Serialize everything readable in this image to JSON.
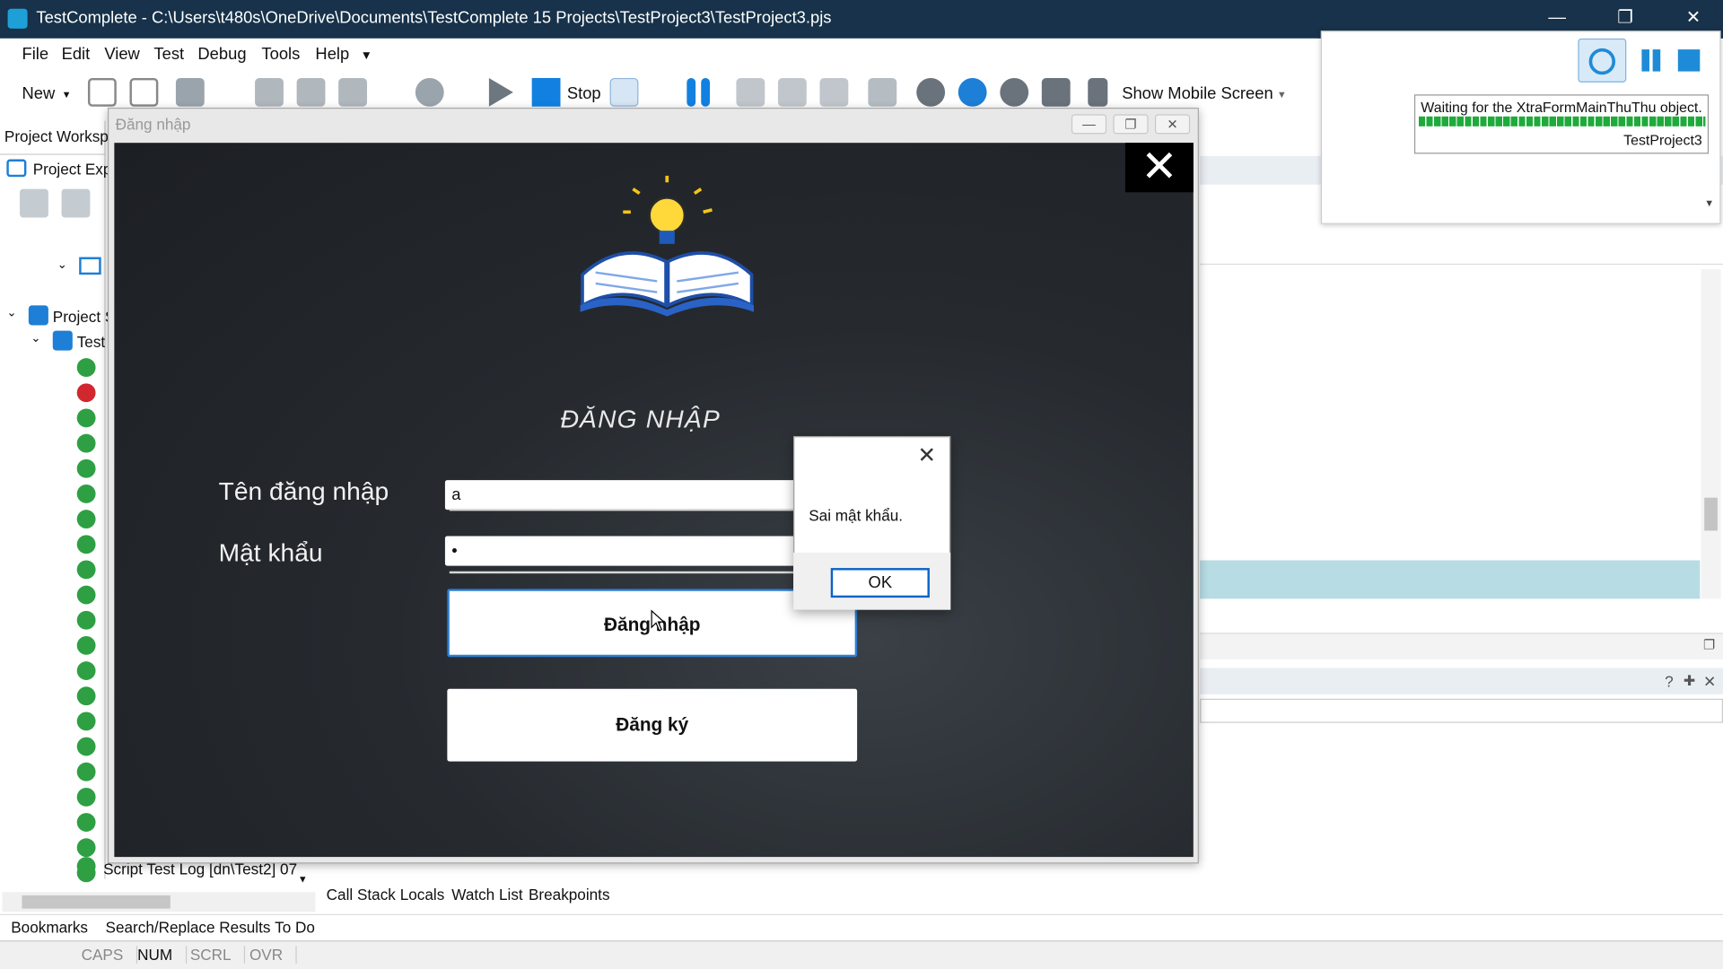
{
  "window": {
    "title": "TestComplete - C:\\Users\\t480s\\OneDrive\\Documents\\TestComplete 15 Projects\\TestProject3\\TestProject3.pjs",
    "minimize": "—",
    "restore": "❐",
    "close": "✕"
  },
  "menu": {
    "items": [
      "File",
      "Edit",
      "View",
      "Test",
      "Debug",
      "Tools",
      "Help"
    ]
  },
  "toolbar": {
    "new_label": "New",
    "stop_label": "Stop",
    "mobile_label": "Show Mobile Screen"
  },
  "left_panel": {
    "workspace_tab": "Project Workspa",
    "explorer_tab": "Project Exp",
    "node_project_suite": "Project S",
    "node_test": "Test",
    "log_item": "Script Test Log [dn\\Test2] 07"
  },
  "playback": {
    "status_text": "Waiting for the XtraFormMainThuThu object.",
    "project_name": "TestProject3",
    "pause_icon": "pause-icon",
    "stop_icon": "stop-icon"
  },
  "login_window": {
    "title": "Đăng nhập",
    "heading": "ĐĂNG NHẬP",
    "username_label": "Tên đăng nhập",
    "username_value": "a",
    "password_label": "Mật khẩu",
    "password_value": "•",
    "login_button": "Đăng nhập",
    "register_button": "Đăng ký",
    "close_glyph": "✕"
  },
  "message_box": {
    "text": "Sai mật khẩu.",
    "ok_label": "OK",
    "close_glyph": "✕"
  },
  "bottom_tabs": [
    "Call Stack",
    "Locals",
    "Watch List",
    "Breakpoints"
  ],
  "bottom_tabs2": [
    "Bookmarks",
    "Search/Replace Results",
    "To Do"
  ],
  "status_bar": [
    "CAPS",
    "NUM",
    "SCRL",
    "OVR"
  ],
  "colors": {
    "titlebar": "#17324a",
    "ok_border": "#0a64c8",
    "progress": "#1faa3b",
    "highlight": "#b7dce4"
  }
}
